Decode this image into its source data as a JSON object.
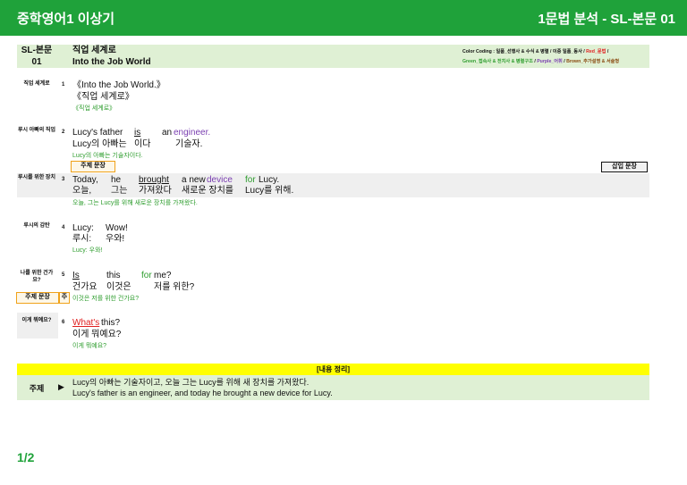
{
  "header": {
    "left_title": "중학영어1 이상기",
    "right_title": "1문법 분석 - SL-본문 01"
  },
  "lesson": {
    "code_line1": "SL-본문",
    "code_line2": "01",
    "title_ko": "직업 세계로",
    "title_en": "Into the Job World"
  },
  "legend": {
    "line1_prefix": "Color Coding : 일품_선행사 & 수식 & 병렬 / 이중 일품_동사 / ",
    "line1_red": "Red_문법",
    "line1_suffix": " /",
    "line2_green": "Green_접속사 & 전치사 & 병렬구조",
    "line2_sep1": " / ",
    "line2_purple": "Purple_어휘",
    "line2_sep2": " / ",
    "line2_brown": "Brown_추가설명 & 서술형",
    "colors": {
      "red": "#e02020",
      "green": "#2e9d2e",
      "purple": "#7a3fb0",
      "brown": "#8a4b12"
    }
  },
  "rows": {
    "r1": {
      "label": "직업 세계로",
      "num": "1",
      "en": "《Into the Job World.》",
      "ko": "《직업 세계로》",
      "tr": "《직업 세계로》"
    },
    "r2": {
      "label": "루시 아빠의 직업",
      "num": "2",
      "w": [
        "Lucy's father",
        "is",
        "an",
        "engineer."
      ],
      "k": [
        "Lucy의 아빠는",
        "이다",
        "기술자."
      ],
      "tr": "Lucy의 아빠는 기술자이다."
    },
    "r3": {
      "label": "루시를 위한 장치",
      "num": "3",
      "tag": "주제 문장",
      "insert": "삽입 문장",
      "w": [
        "Today,",
        "he",
        "brought",
        "a new",
        "device",
        "for",
        "Lucy."
      ],
      "k": [
        "오늘,",
        "그는",
        "가져왔다",
        "새로운 장치를",
        "Lucy를 위해."
      ],
      "tr": "오늘, 그는 Lucy를 위해 새로운 장치를 가져왔다."
    },
    "r4": {
      "label": "루시의 감탄",
      "num": "4",
      "w": [
        "Lucy:",
        "Wow!"
      ],
      "k": [
        "루시:",
        "우와!"
      ],
      "tr": "Lucy: 우와!"
    },
    "r5": {
      "label": "나를 위한 건가요?",
      "num": "5",
      "tag": "주제 문장",
      "tag2": "주",
      "w": [
        "Is",
        "this",
        "for",
        "me?"
      ],
      "k": [
        "건가요",
        "이것은",
        "저를 위한?"
      ],
      "tr": "이것은 저를 위한 건가요?"
    },
    "r6": {
      "label": "이게 뭐예요?",
      "num": "6",
      "w": [
        "What's",
        "this?"
      ],
      "k": "이게 뭐예요?",
      "tr": "이게 뭐예요?"
    }
  },
  "summary": {
    "banner": "[내용 정리]",
    "label": "주제",
    "arrow": "▶",
    "ko": "Lucy의 아빠는 기술자이고, 오늘 그는 Lucy를 위해 새 장치를 가져왔다.",
    "en": "Lucy's father is an engineer, and today he brought a new device for Lucy."
  },
  "page": "1/2"
}
